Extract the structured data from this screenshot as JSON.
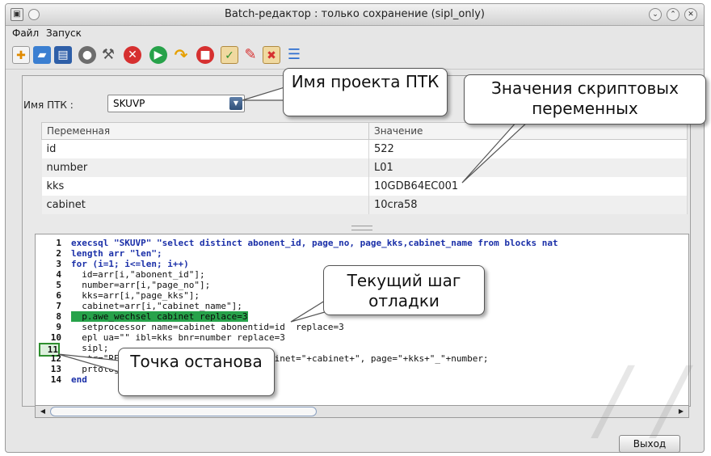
{
  "window": {
    "title": "Batch-редактор : только сохранение (sipl_only)"
  },
  "menu": [
    "Файл",
    "Запуск"
  ],
  "toolbar_icons": [
    "new-file-icon",
    "open-folder-icon",
    "save-icon",
    "stop-icon",
    "wrench-icon",
    "close-red-icon",
    "run-green-icon",
    "step-over-icon",
    "stop-red-icon",
    "clipboard-icon",
    "eraser-icon",
    "delete-x-icon",
    "list-icon"
  ],
  "project": {
    "label": "Имя ПТК :",
    "value": "SKUVP"
  },
  "variables": {
    "columns": [
      "Переменная",
      "Значение"
    ],
    "rows": [
      [
        "id",
        "522"
      ],
      [
        "number",
        "L01"
      ],
      [
        "kks",
        "10GDB64EC001"
      ],
      [
        "cabinet",
        "10cra58"
      ]
    ]
  },
  "code": {
    "line_numbers": [
      "1",
      "2",
      "3",
      "4",
      "5",
      "6",
      "7",
      "8",
      "9",
      "10",
      "11",
      "12",
      "13",
      "14"
    ],
    "lines": [
      "execsql \"SKUVP\" \"select distinct abonent_id, page_no, page_kks,cabinet_name from blocks nat",
      "length arr \"len\";",
      "for (i=1; i<=len; i++)",
      "  id=arr[i,\"abonent_id\"];",
      "  number=arr[i,\"page_no\"];",
      "  kks=arr[i,\"page_kks\"];",
      "  cabinet=arr[i,\"cabinet_name\"];",
      "  p.awe_wechsel cabinet replace=3",
      "  setprocessor name=cabinet abonentid=id  replace=3",
      "  epl ua=\"\" ibl=kks bnr=number replace=3",
      "  sipl;",
      "  str=\"READY: \"+i+\" \"+len+\" pages; cabinet=\"+cabinet+\", page=\"+kks+\"_\"+number;",
      "  prtolog str;",
      "end"
    ],
    "current_line": 8,
    "breakpoint_line": 11
  },
  "buttons": {
    "exit": "Выход"
  },
  "callouts": {
    "project_name": "Имя проекта ПТК",
    "script_vars": "Значения скриптовых переменных",
    "debug_step": "Текущий шаг отладки",
    "breakpoint": "Точка останова"
  },
  "colors": {
    "current_line_bg": "#27a24a",
    "keyword": "#1a2fa8",
    "breakpoint_border": "#2f8f2f"
  }
}
